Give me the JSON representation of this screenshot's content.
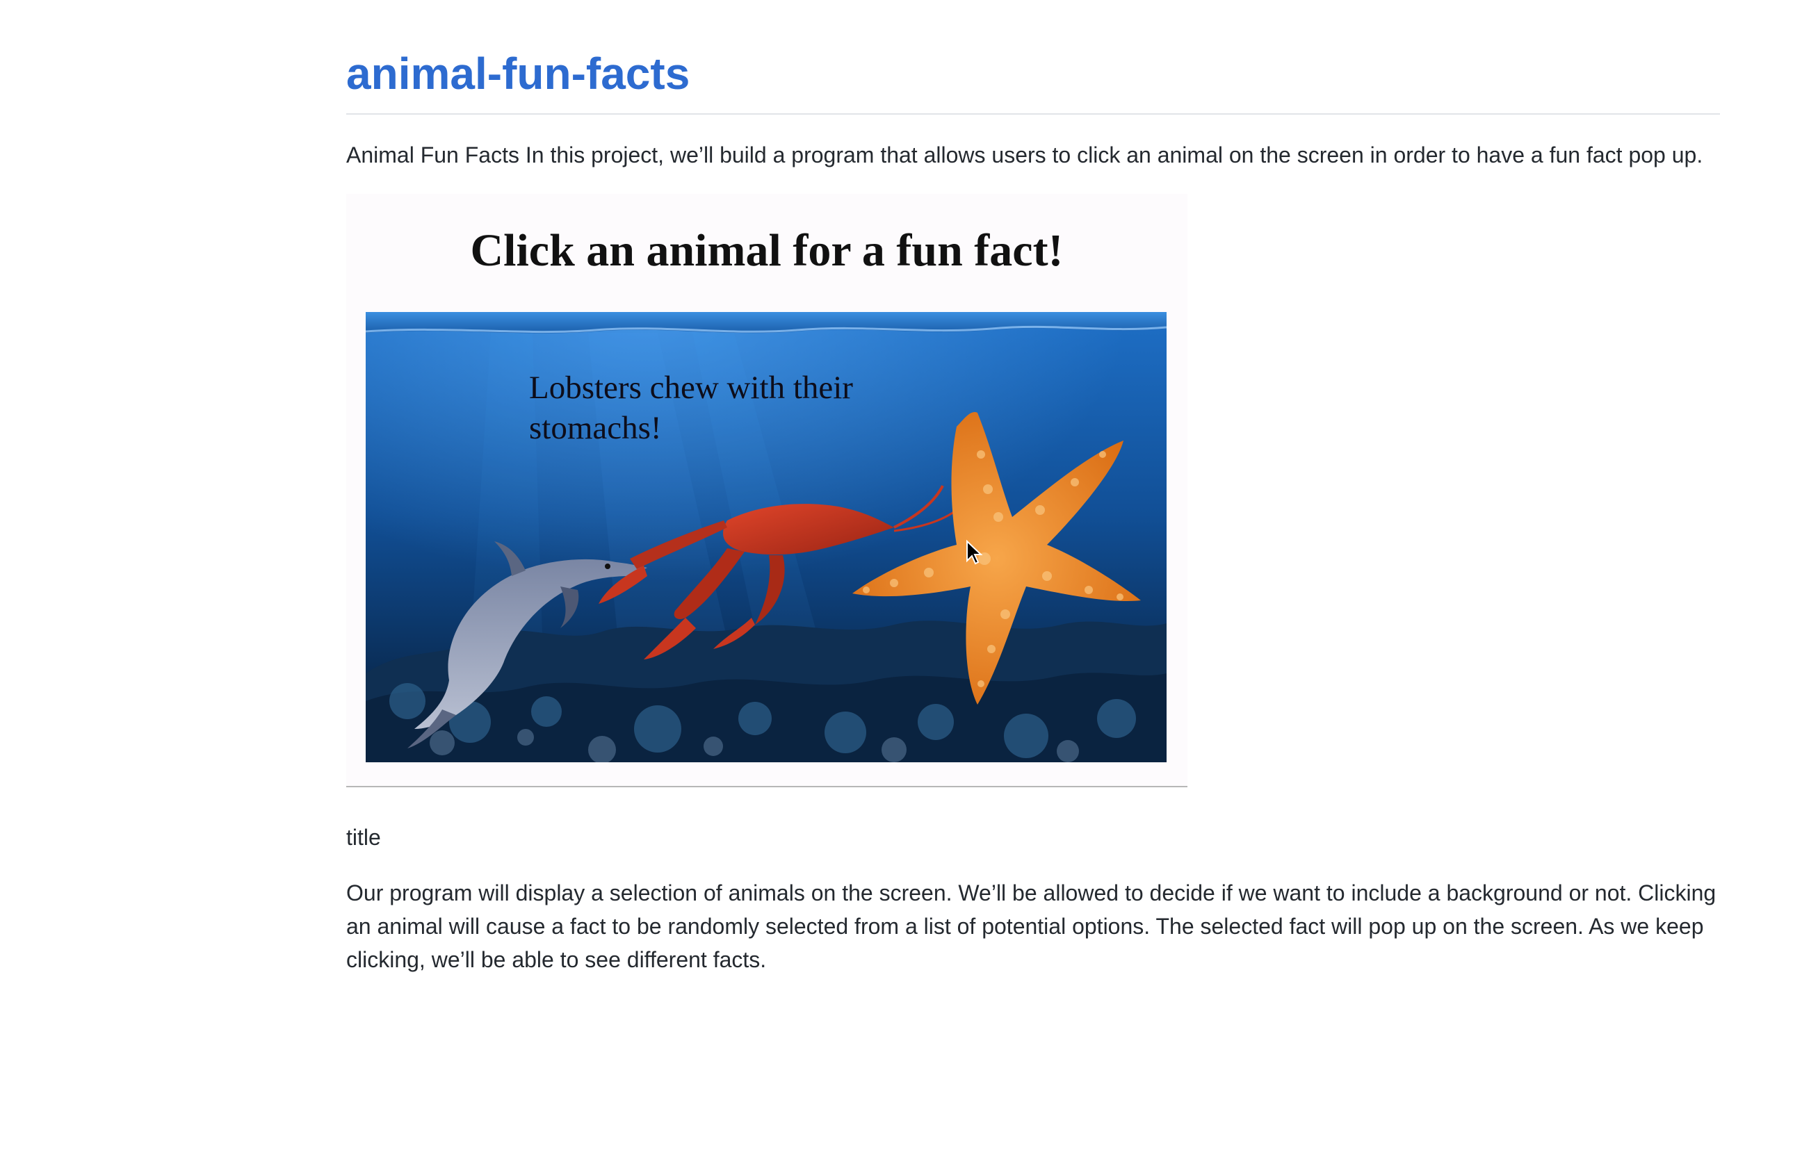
{
  "page": {
    "title": "animal-fun-facts",
    "intro": "Animal Fun Facts In this project, we’ll build a program that allows users to click an animal on the screen in order to have a fun fact pop up.",
    "caption": "title",
    "body": "Our program will display a selection of animals on the screen. We’ll be allowed to decide if we want to include a background or not. Clicking an animal will cause a fact to be randomly selected from a list of potential options. The selected fact will pop up on the screen. As we keep clicking, we’ll be able to see different facts."
  },
  "figure": {
    "heading": "Click an animal for a fun fact!",
    "fact": "Lobsters chew with their stomachs!",
    "animals": [
      "dolphin",
      "lobster",
      "starfish"
    ],
    "colors": {
      "water_top": "#1a63b8",
      "water_bottom": "#07203f",
      "starfish": "#f08a24",
      "lobster": "#c8361f",
      "dolphin": "#6c7894"
    }
  }
}
